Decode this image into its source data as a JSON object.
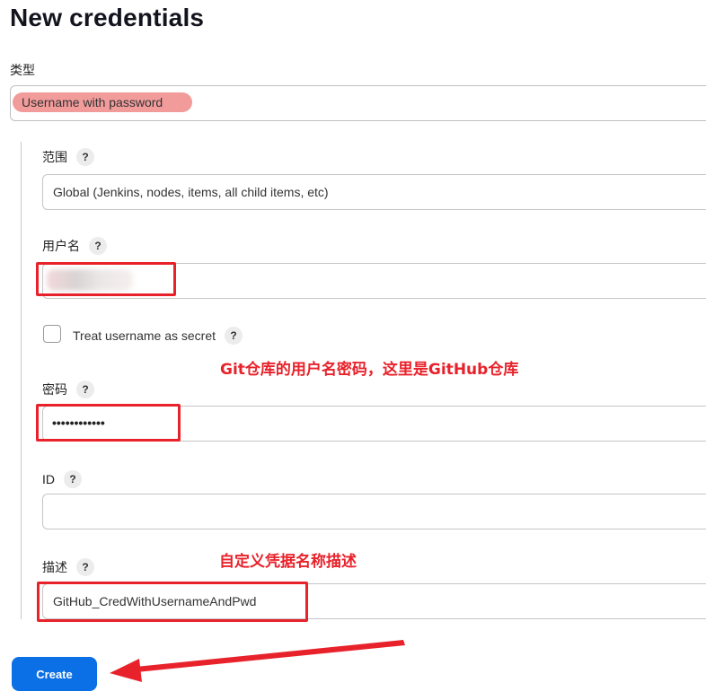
{
  "page": {
    "title": "New credentials"
  },
  "kind": {
    "label": "类型",
    "value": "Username with password"
  },
  "scope": {
    "label": "范围",
    "help": "?",
    "value": "Global (Jenkins, nodes, items, all child items, etc)"
  },
  "username": {
    "label": "用户名",
    "help": "?",
    "value": ""
  },
  "username_secret": {
    "label": "Treat username as secret",
    "help": "?",
    "checked": false
  },
  "password": {
    "label": "密码",
    "help": "?",
    "value": "••••••••••••"
  },
  "id": {
    "label": "ID",
    "help": "?",
    "value": ""
  },
  "description": {
    "label": "描述",
    "help": "?",
    "value": "GitHub_CredWithUsernameAndPwd"
  },
  "annotations": {
    "credentials_note": "Git仓库的用户名密码，这里是GitHub仓库",
    "description_note": "自定义凭据名称描述",
    "color": "#e8222b"
  },
  "actions": {
    "create_label": "Create",
    "create_color": "#0b6fe5"
  }
}
